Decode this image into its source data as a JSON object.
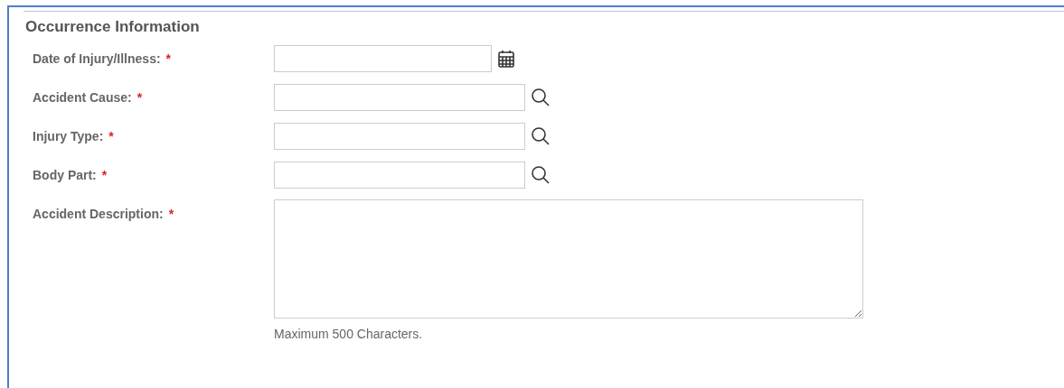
{
  "section": {
    "title": "Occurrence Information"
  },
  "fields": [
    {
      "kind": "date",
      "label": "Date of Injury/Illness:",
      "required_mark": "*"
    },
    {
      "kind": "lookup",
      "label": "Accident Cause:",
      "required_mark": "*"
    },
    {
      "kind": "lookup",
      "label": "Injury Type:",
      "required_mark": "*"
    },
    {
      "kind": "lookup",
      "label": "Body Part:",
      "required_mark": "*"
    },
    {
      "kind": "textarea",
      "label": "Accident Description:",
      "required_mark": "*",
      "hint": "Maximum 500 Characters."
    }
  ]
}
